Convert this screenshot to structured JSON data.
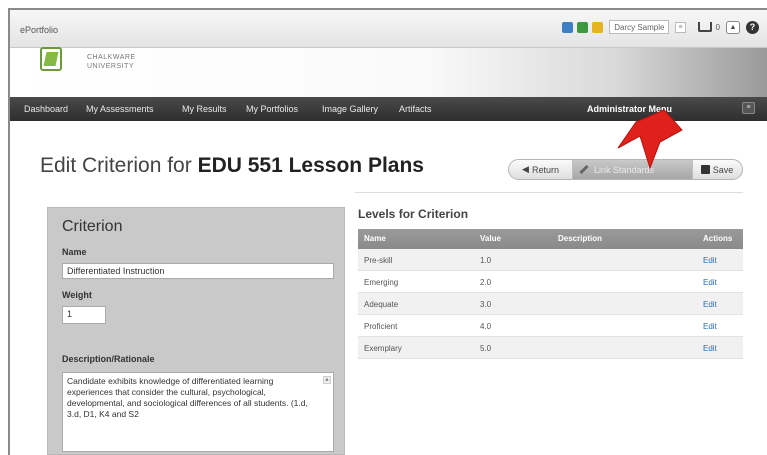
{
  "topbar": {
    "app_name": "ePortfolio",
    "user_name": "Darcy Sample",
    "inbox_count": "0",
    "dropdown_glyph": "≡",
    "up_glyph": "▲",
    "help_glyph": "?"
  },
  "logo": {
    "line1": "CHALKWARE",
    "line2": "UNIVERSITY"
  },
  "nav": {
    "items": [
      "Dashboard",
      "My Assessments",
      "My Results",
      "My Portfolios",
      "Image Gallery",
      "Artifacts"
    ],
    "admin_menu": "Administrator Menu",
    "dropdown_glyph": "≡"
  },
  "page": {
    "title_prefix": "Edit Criterion for ",
    "title_name": "EDU 551 Lesson Plans"
  },
  "actions": {
    "return_label": "Return",
    "link_label": "Link Standards",
    "save_label": "Save"
  },
  "criterion": {
    "panel_title": "Criterion",
    "name_label": "Name",
    "name_value": "Differentiated Instruction",
    "weight_label": "Weight",
    "weight_value": "1",
    "desc_label": "Description/Rationale",
    "desc_value": "Candidate exhibits knowledge of differentiated learning experiences that consider the cultural, psychological, developmental, and sociological differences of all students.  (1.d, 3.d, D1, K4 and S2"
  },
  "levels": {
    "title": "Levels for Criterion",
    "headers": [
      "Name",
      "Value",
      "Description",
      "Actions"
    ],
    "rows": [
      {
        "name": "Pre-skill",
        "value": "1.0",
        "description": "",
        "action": "Edit"
      },
      {
        "name": "Emerging",
        "value": "2.0",
        "description": "",
        "action": "Edit"
      },
      {
        "name": "Adequate",
        "value": "3.0",
        "description": "",
        "action": "Edit"
      },
      {
        "name": "Proficient",
        "value": "4.0",
        "description": "",
        "action": "Edit"
      },
      {
        "name": "Exemplary",
        "value": "5.0",
        "description": "",
        "action": "Edit"
      }
    ]
  },
  "colors": {
    "nav_bg": "#333333",
    "panel_bg": "#c9c9c9",
    "link_blue": "#2a6fb3",
    "accent_red": "#e0201a"
  },
  "icons": [
    "app-blue-icon",
    "app-green-icon",
    "app-yellow-icon",
    "inbox-icon",
    "help-icon",
    "return-arrow-icon",
    "pencil-icon",
    "save-disk-icon",
    "red-pointer-arrow-icon"
  ]
}
